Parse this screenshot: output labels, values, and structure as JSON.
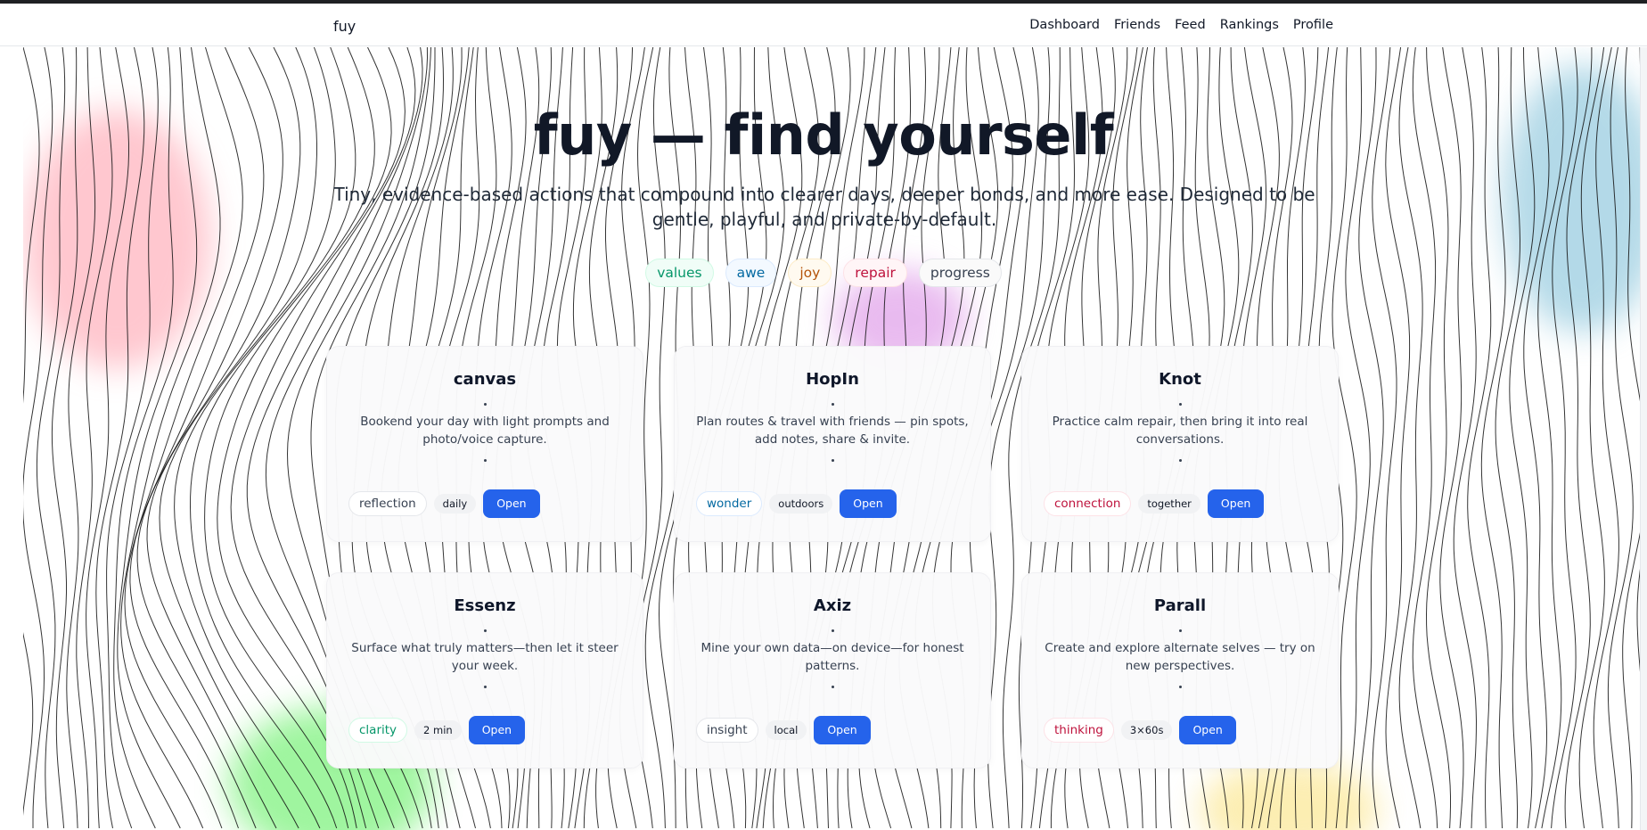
{
  "nav": {
    "brand": "fuy",
    "links": [
      "Dashboard",
      "Friends",
      "Feed",
      "Rankings",
      "Profile"
    ]
  },
  "hero": {
    "title": "fuy — find yourself",
    "subtitle": "Tiny, evidence-based actions that compound into clearer days, deeper bonds, and more ease. Designed to be gentle, playful, and private-by-default."
  },
  "tags": [
    {
      "label": "values",
      "color": "#059669",
      "border": "#d1fae5",
      "bg": "#f0fdf7"
    },
    {
      "label": "awe",
      "color": "#0369a1",
      "border": "#dbeafe",
      "bg": "#f3f9ff"
    },
    {
      "label": "joy",
      "color": "#b45309",
      "border": "#fdecc8",
      "bg": "#fffaf0"
    },
    {
      "label": "repair",
      "color": "#be123c",
      "border": "#fde2e7",
      "bg": "#fff5f7"
    },
    {
      "label": "progress",
      "color": "#374151",
      "border": "#e5e7eb",
      "bg": "#fafafa"
    }
  ],
  "cards": [
    {
      "title": "canvas",
      "desc": "Bookend your day with light prompts and photo/voice capture.",
      "tag": "reflection",
      "tag_color": "#374151",
      "tag_border": "#e5e7eb",
      "pill": "daily",
      "button": "Open"
    },
    {
      "title": "HopIn",
      "desc": "Plan routes & travel with friends — pin spots, add notes, share & invite.",
      "tag": "wonder",
      "tag_color": "#0369a1",
      "tag_border": "#dbeafe",
      "pill": "outdoors",
      "button": "Open"
    },
    {
      "title": "Knot",
      "desc": "Practice calm repair, then bring it into real conversations.",
      "tag": "connection",
      "tag_color": "#be123c",
      "tag_border": "#fde2e7",
      "pill": "together",
      "button": "Open"
    },
    {
      "title": "Essenz",
      "desc": "Surface what truly matters—then let it steer your week.",
      "tag": "clarity",
      "tag_color": "#059669",
      "tag_border": "#d1fae5",
      "pill": "2 min",
      "button": "Open"
    },
    {
      "title": "Axiz",
      "desc": "Mine your own data—on device—for honest patterns.",
      "tag": "insight",
      "tag_color": "#374151",
      "tag_border": "#e5e7eb",
      "pill": "local",
      "button": "Open"
    },
    {
      "title": "Parall",
      "desc": "Create and explore alternate selves — try on new perspectives.",
      "tag": "thinking",
      "tag_color": "#be123c",
      "tag_border": "#fde2e7",
      "pill": "3×60s",
      "button": "Open"
    }
  ]
}
